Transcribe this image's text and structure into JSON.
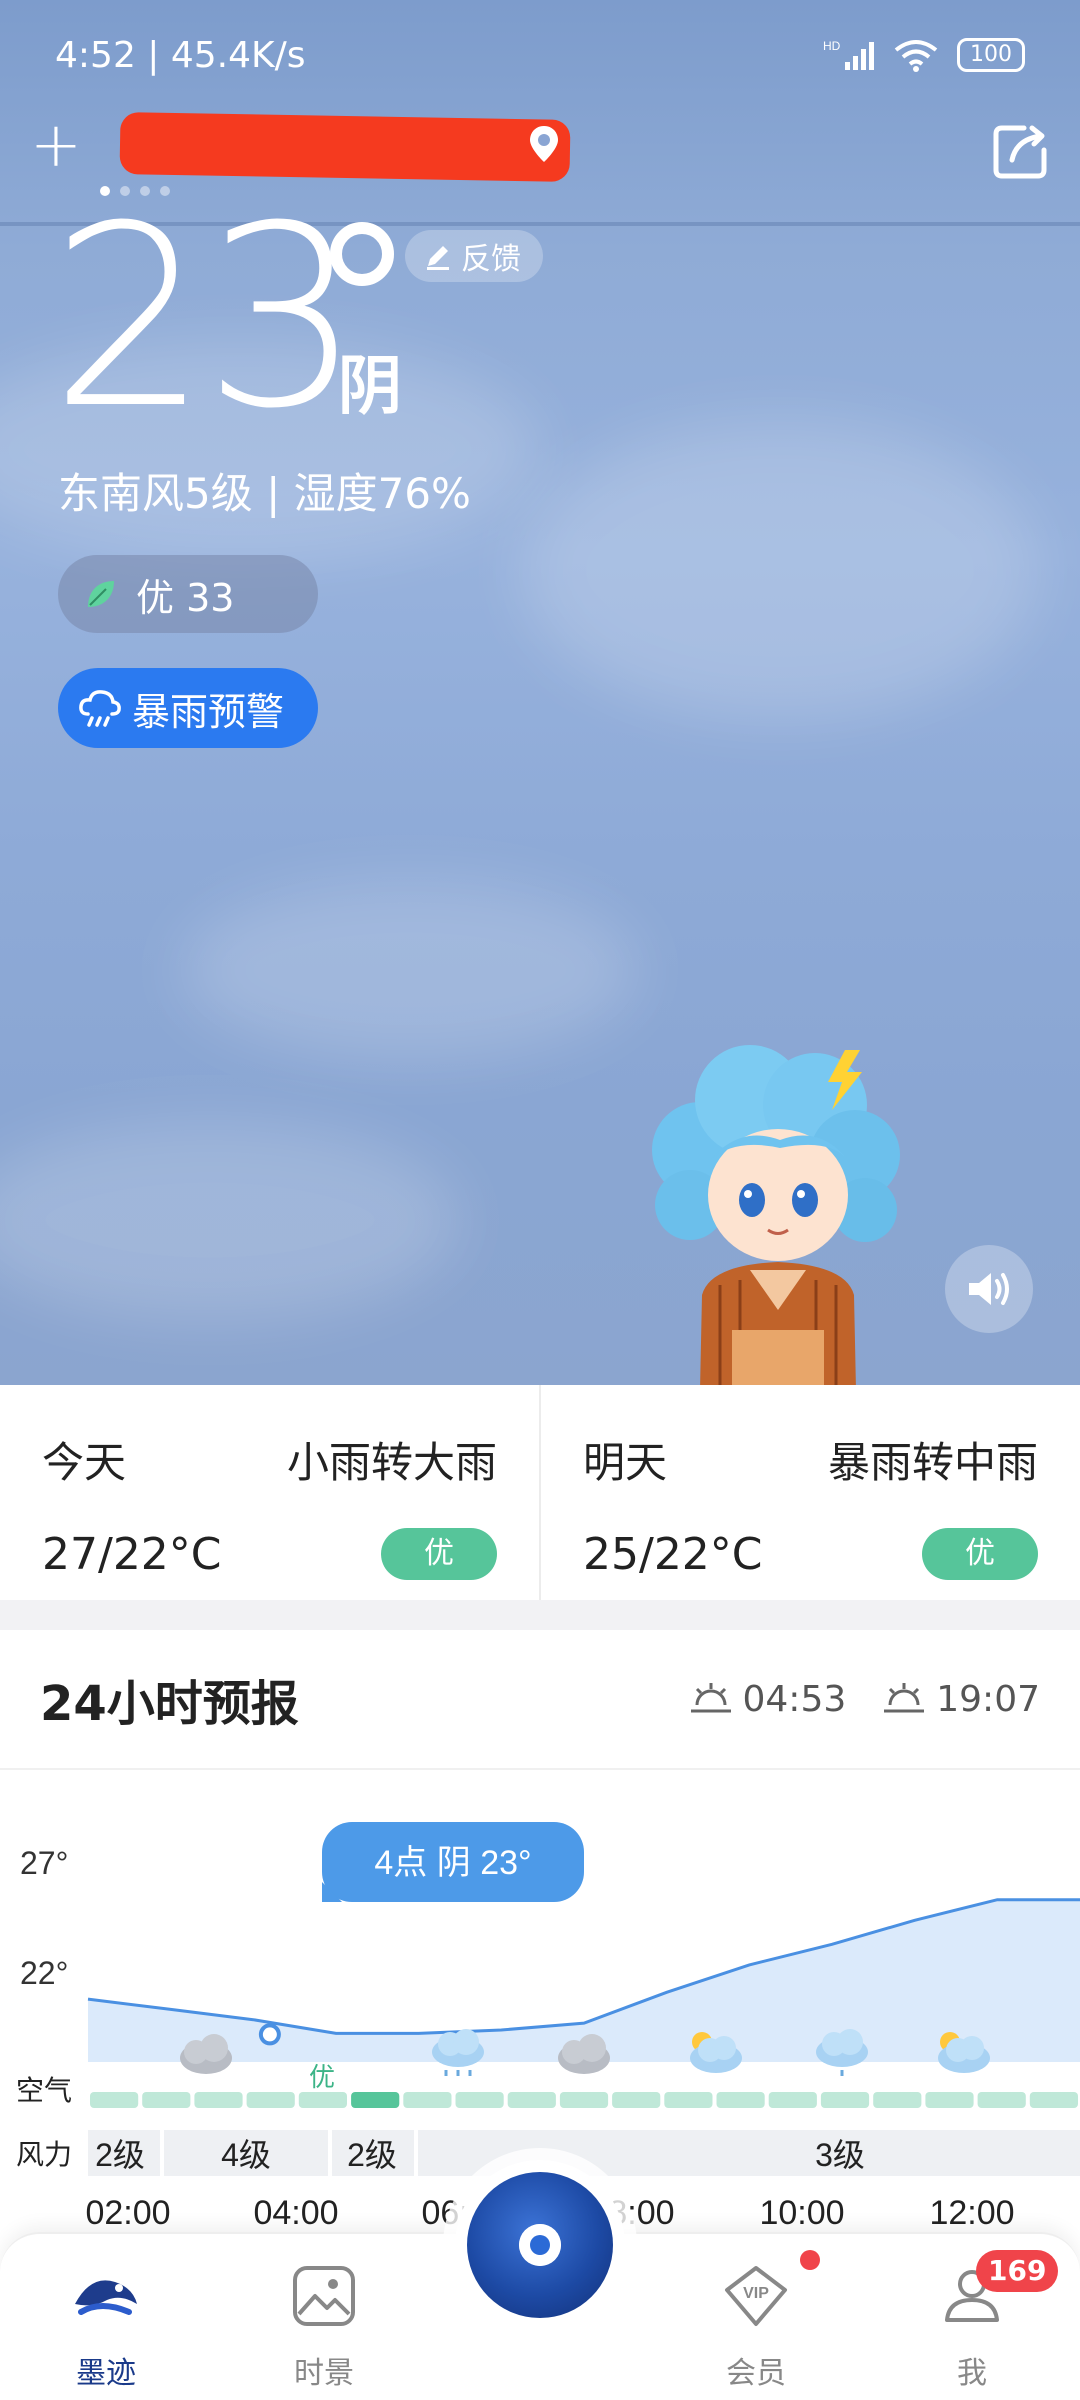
{
  "status_bar": {
    "time": "4:52 | 45.4K/s",
    "battery": "100"
  },
  "header": {
    "add_label": "+"
  },
  "current": {
    "temperature": "23",
    "condition": "阴",
    "feedback_label": "反馈",
    "wind_humidity": "东南风5级 | 湿度76%",
    "aqi_label": "优 33",
    "alert_label": "暴雨预警"
  },
  "days": [
    {
      "name": "今天",
      "weather": "小雨转大雨",
      "temps": "27/22°C",
      "aqi": "优"
    },
    {
      "name": "明天",
      "weather": "暴雨转中雨",
      "temps": "25/22°C",
      "aqi": "优"
    }
  ],
  "forecast": {
    "title": "24小时预报",
    "sunrise": "04:53",
    "sunset": "19:07",
    "y_labels": [
      "27°",
      "22°"
    ],
    "tooltip": "4点 阴 23°",
    "air_label": "空气",
    "air_badge": "优",
    "wind_label": "风力",
    "wind_levels": [
      "2级",
      "4级",
      "2级",
      "3级"
    ],
    "times": [
      "02:00",
      "04:00",
      "06:00",
      "08:00",
      "10:00",
      "12:00"
    ]
  },
  "chart_data": {
    "type": "line",
    "x": [
      "01:00",
      "02:00",
      "03:00",
      "04:00",
      "05:00",
      "06:00",
      "07:00",
      "08:00",
      "09:00",
      "10:00",
      "11:00",
      "12:00",
      "13:00"
    ],
    "y": [
      24,
      23.7,
      23.4,
      23,
      23,
      23.1,
      23.3,
      24.2,
      25,
      25.6,
      26.3,
      26.9,
      26.9
    ],
    "ylim": [
      21,
      28
    ],
    "colors": {
      "line": "#4a90e2",
      "fill": "#cfe3fa",
      "air_good": "#bfe8d8",
      "air_selected": "#56c59a"
    }
  },
  "nav": {
    "items": [
      {
        "label": "墨迹",
        "icon": "moji-logo-icon"
      },
      {
        "label": "时景",
        "icon": "photo-icon"
      },
      {
        "label": "会员",
        "icon": "vip-icon"
      },
      {
        "label": "我",
        "icon": "user-icon"
      }
    ],
    "badge_count": "169"
  }
}
